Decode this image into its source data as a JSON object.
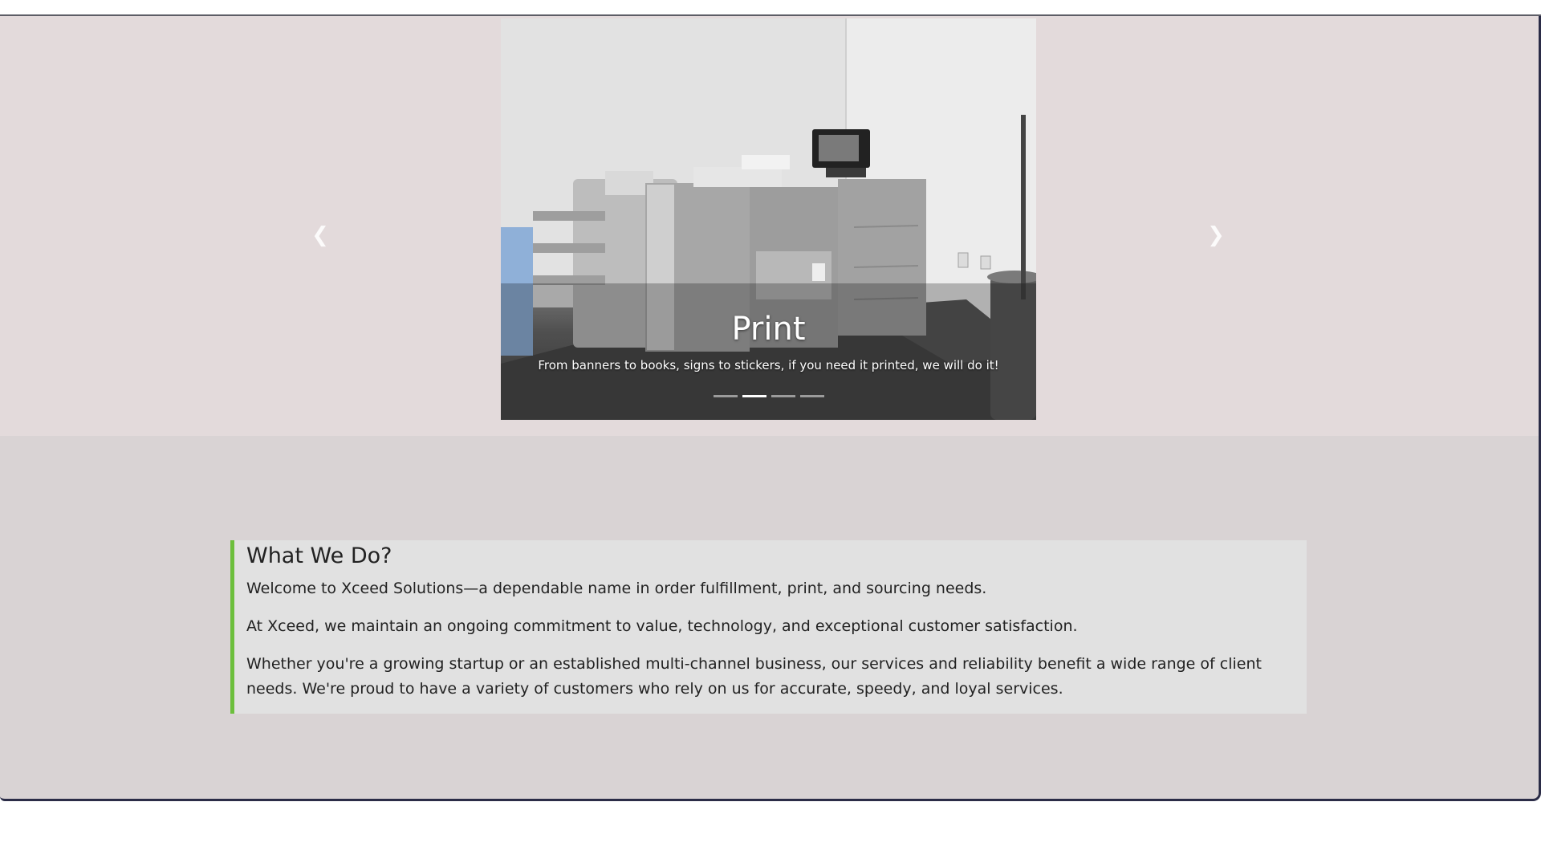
{
  "carousel": {
    "slide_title": "Print",
    "slide_caption": "From banners to books, signs to stickers, if you need it printed, we will do it!",
    "indicators_total": 4,
    "active_indicator": 2,
    "prev_icon": "chevron-left-icon",
    "next_icon": "chevron-right-icon"
  },
  "about": {
    "heading": "What We Do?",
    "paragraphs": [
      "Welcome to Xceed Solutions—a dependable name in order fulfillment, print, and sourcing needs.",
      "At Xceed, we maintain an ongoing commitment to value, technology, and exceptional customer satisfaction.",
      "Whether you're a growing startup or an established multi-channel business, our services and reliability benefit a wide range of client needs. We're proud to have a variety of customers who rely on us for accurate, speedy, and loyal services."
    ]
  },
  "colors": {
    "accent_border": "#6cbf3c",
    "carousel_band": "#e3dadb",
    "page_background": "#d9d3d4",
    "card_background": "#e1e1e1"
  }
}
